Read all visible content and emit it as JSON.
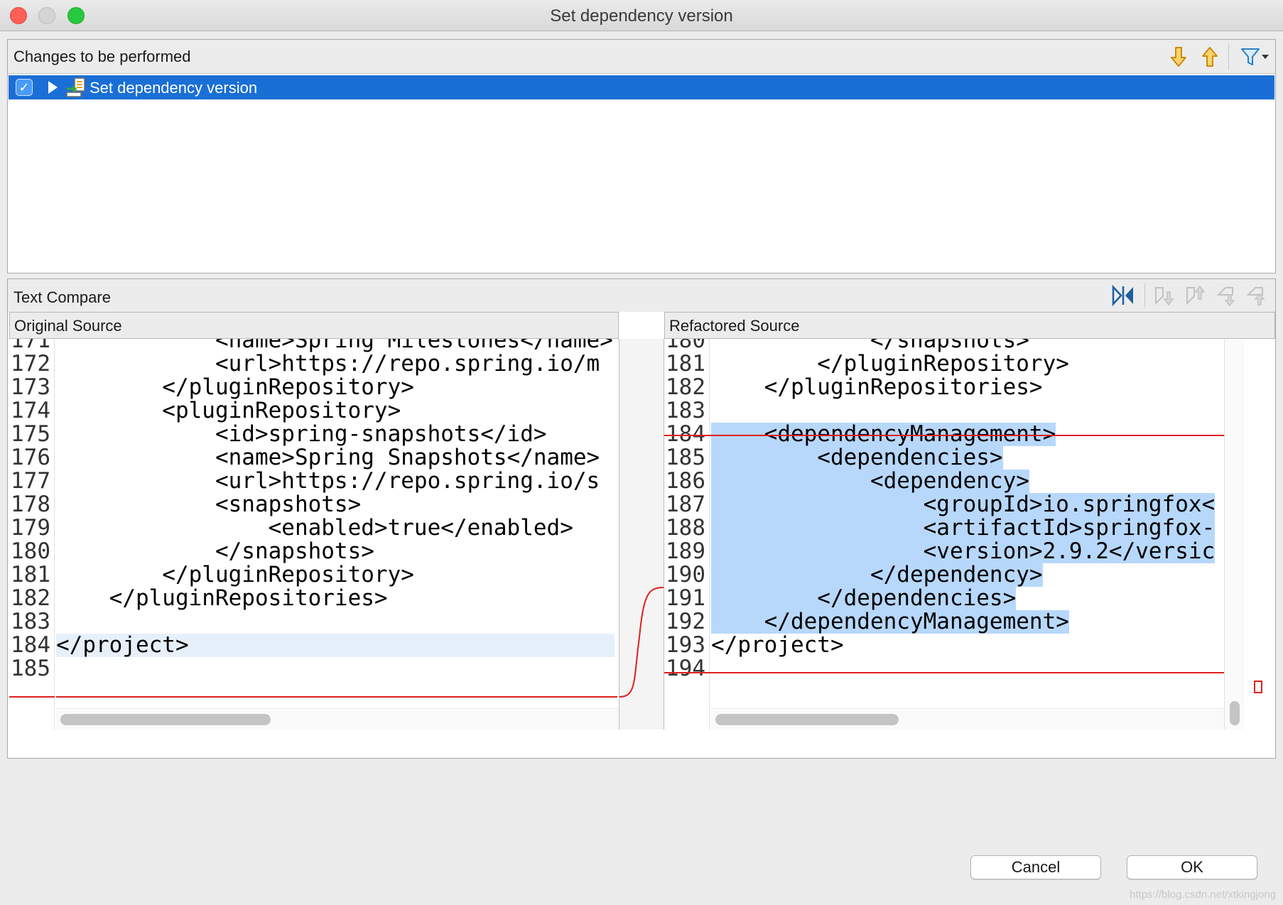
{
  "window": {
    "title": "Set dependency version"
  },
  "changes": {
    "header": "Changes to be performed",
    "tree_item": {
      "label": "Set dependency version",
      "checked": true
    }
  },
  "compare": {
    "header": "Text Compare",
    "left": {
      "title": "Original Source",
      "lines": [
        {
          "num": "171",
          "text": "            <name>Spring Milestones</name>"
        },
        {
          "num": "172",
          "text": "            <url>https://repo.spring.io/m"
        },
        {
          "num": "173",
          "text": "        </pluginRepository>"
        },
        {
          "num": "174",
          "text": "        <pluginRepository>"
        },
        {
          "num": "175",
          "text": "            <id>spring-snapshots</id>"
        },
        {
          "num": "176",
          "text": "            <name>Spring Snapshots</name>"
        },
        {
          "num": "177",
          "text": "            <url>https://repo.spring.io/s"
        },
        {
          "num": "178",
          "text": "            <snapshots>"
        },
        {
          "num": "179",
          "text": "                <enabled>true</enabled>"
        },
        {
          "num": "180",
          "text": "            </snapshots>"
        },
        {
          "num": "181",
          "text": "        </pluginRepository>"
        },
        {
          "num": "182",
          "text": "    </pluginRepositories>"
        },
        {
          "num": "183",
          "text": ""
        },
        {
          "num": "184",
          "text": "</project>"
        },
        {
          "num": "185",
          "text": ""
        }
      ]
    },
    "right": {
      "title": "Refactored Source",
      "lines": [
        {
          "num": "180",
          "text": "            </snapshots>"
        },
        {
          "num": "181",
          "text": "        </pluginRepository>"
        },
        {
          "num": "182",
          "text": "    </pluginRepositories>"
        },
        {
          "num": "183",
          "text": ""
        },
        {
          "num": "184",
          "text": "    <dependencyManagement>"
        },
        {
          "num": "185",
          "text": "        <dependencies>"
        },
        {
          "num": "186",
          "text": "            <dependency>"
        },
        {
          "num": "187",
          "text": "                <groupId>io.springfox<"
        },
        {
          "num": "188",
          "text": "                <artifactId>springfox-"
        },
        {
          "num": "189",
          "text": "                <version>2.9.2</versic"
        },
        {
          "num": "190",
          "text": "            </dependency>"
        },
        {
          "num": "191",
          "text": "        </dependencies>"
        },
        {
          "num": "192",
          "text": "    </dependencyManagement>"
        },
        {
          "num": "193",
          "text": "</project>"
        },
        {
          "num": "194",
          "text": ""
        }
      ]
    }
  },
  "buttons": {
    "cancel": "Cancel",
    "ok": "OK"
  },
  "watermark": "https://blog.csdn.net/xtkingjong",
  "colors": {
    "selection": "#1a6fd6",
    "diff_highlight": "#b7d8fb",
    "diff_border": "#e0201c",
    "accent_icon": "#e8a317"
  }
}
